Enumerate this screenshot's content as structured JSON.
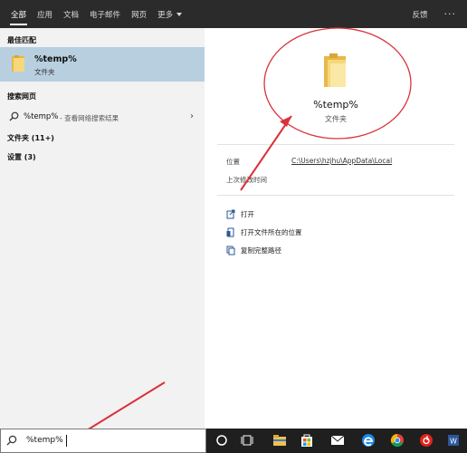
{
  "top_tabs": [
    {
      "label": "全部",
      "active": true
    },
    {
      "label": "应用",
      "active": false
    },
    {
      "label": "文档",
      "active": false
    },
    {
      "label": "电子邮件",
      "active": false
    },
    {
      "label": "网页",
      "active": false
    },
    {
      "label": "更多",
      "active": false
    }
  ],
  "topbar": {
    "feedback": "反馈",
    "more": "···"
  },
  "left": {
    "best_match_header": "最佳匹配",
    "best_match": {
      "name": "%temp%",
      "type": "文件夹"
    },
    "web_header": "搜索网页",
    "web_query": "%temp%",
    "web_hint": " - 查看网络搜索结果",
    "folders": "文件夹 (11+)",
    "settings": "设置 (3)"
  },
  "preview": {
    "title": "%temp%",
    "subtitle": "文件夹",
    "location_label": "位置",
    "location_value": "C:\\Users\\hzjhu\\AppData\\Local",
    "modified_label": "上次修改时间",
    "actions": [
      {
        "label": "打开",
        "icon": "open-icon"
      },
      {
        "label": "打开文件所在的位置",
        "icon": "file-location-icon"
      },
      {
        "label": "复制完整路径",
        "icon": "copy-path-icon"
      }
    ]
  },
  "taskbar": {
    "search_text": "%temp%",
    "icons": [
      "cortana-circle-icon",
      "task-view-icon",
      "file-explorer-icon",
      "store-icon",
      "mail-icon",
      "edge-icon",
      "chrome-icon",
      "netease-music-icon",
      "word-icon"
    ]
  },
  "colors": {
    "topbar": "#2b2b2b",
    "left_pane": "#f2f2f2",
    "selected": "#b8cfe0",
    "annotation": "#d9323a",
    "taskbar": "#1f1f1f"
  }
}
